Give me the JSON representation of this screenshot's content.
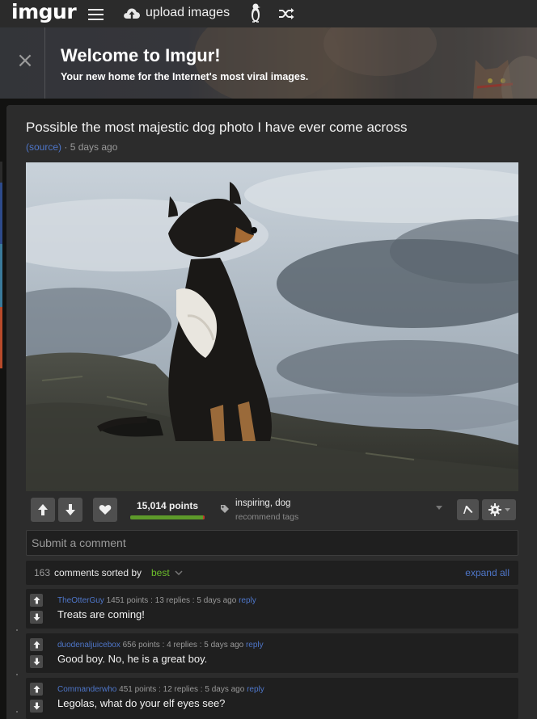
{
  "nav": {
    "logo": "imgur",
    "upload_label": "upload images"
  },
  "banner": {
    "close_glyph": "×",
    "title": "Welcome to Imgur!",
    "subtitle": "Your new home for the Internet's most viral images."
  },
  "post": {
    "title": "Possible the most majestic dog photo I have ever come across",
    "source_label": "(source)",
    "age": "· 5 days ago",
    "image_alt": "dog sitting on a rock under a cloudy sky"
  },
  "actions": {
    "points": "15,014 points",
    "upvote_ratio": 0.98,
    "tags": "inspiring, dog",
    "recommend_tags": "recommend tags"
  },
  "comment_box": {
    "placeholder": "Submit a comment"
  },
  "sort": {
    "count": "163",
    "label": "comments sorted by",
    "sort_value": "best",
    "expand_all": "expand all"
  },
  "comments": [
    {
      "user": "TheOtterGuy",
      "points": "1451 points",
      "replies": ": 13 replies",
      "age": ": 5 days ago",
      "reply": "reply",
      "text": "Treats are coming!"
    },
    {
      "user": "duodenaljuicebox",
      "points": "656 points",
      "replies": ": 4 replies",
      "age": ": 5 days ago",
      "reply": "reply",
      "text": "Good boy. No, he is a great boy."
    },
    {
      "user": "Commanderwho",
      "points": "451 points",
      "replies": ": 12 replies",
      "age": ": 5 days ago",
      "reply": "reply",
      "text": "Legolas, what do your elf eyes see?"
    }
  ],
  "colors": {
    "link": "#4e76c9",
    "accent_green": "#6cbf2b",
    "panel": "#2c2c2c"
  },
  "icons": [
    "hamburger-icon",
    "upload-cloud-icon",
    "penguin-icon",
    "shuffle-icon",
    "close-icon",
    "upvote-arrow-icon",
    "downvote-arrow-icon",
    "heart-icon",
    "tag-icon",
    "chevron-down-icon",
    "flag-icon",
    "gear-icon"
  ]
}
